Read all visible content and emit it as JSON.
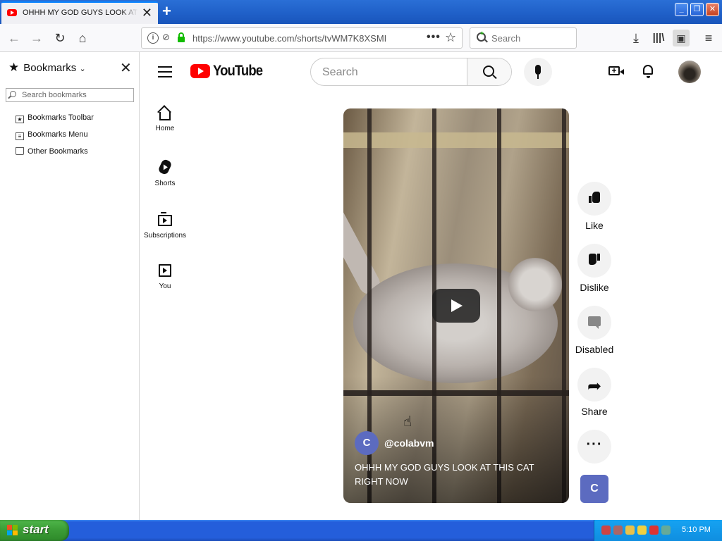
{
  "browser": {
    "tab_title": "OHHH MY GOD GUYS LOOK AT THIS CAT RIGHT NOW",
    "tab_close": "✕",
    "new_tab": "+",
    "url": "https://www.youtube.com/shorts/tvWM7K8XSMI",
    "search_placeholder": "Search",
    "window_buttons": [
      "_",
      "❐",
      "✕"
    ]
  },
  "sidebar": {
    "title": "Bookmarks",
    "search_placeholder": "Search bookmarks",
    "items": [
      {
        "label": "Bookmarks Toolbar",
        "icon": "bookmarks-toolbar-icon"
      },
      {
        "label": "Bookmarks Menu",
        "icon": "bookmarks-menu-icon"
      },
      {
        "label": "Other Bookmarks",
        "icon": "folder-icon"
      }
    ]
  },
  "youtube": {
    "logo_text": "YouTube",
    "search_placeholder": "Search",
    "guide": [
      {
        "label": "Home",
        "icon": "home-icon"
      },
      {
        "label": "Shorts",
        "icon": "shorts-icon"
      },
      {
        "label": "Subscriptions",
        "icon": "subscriptions-icon"
      },
      {
        "label": "You",
        "icon": "you-icon"
      }
    ],
    "short": {
      "channel_initial": "C",
      "channel_handle": "@colabvm",
      "title": "OHHH MY GOD GUYS LOOK AT THIS CAT RIGHT NOW"
    },
    "actions": [
      {
        "label": "Like",
        "icon": "thumbs-up-icon"
      },
      {
        "label": "Dislike",
        "icon": "thumbs-down-icon"
      },
      {
        "label": "Disabled",
        "icon": "comment-icon"
      },
      {
        "label": "Share",
        "icon": "share-icon"
      },
      {
        "label": "",
        "icon": "more-icon"
      }
    ],
    "channel_box_initial": "C"
  },
  "taskbar": {
    "start_label": "start",
    "clock": "5:10 PM"
  },
  "colors": {
    "youtube_red": "#ff0000",
    "channel_avatar": "#5c6bc0",
    "xp_blue": "#245edb",
    "xp_start_green": "#3a9b35"
  }
}
